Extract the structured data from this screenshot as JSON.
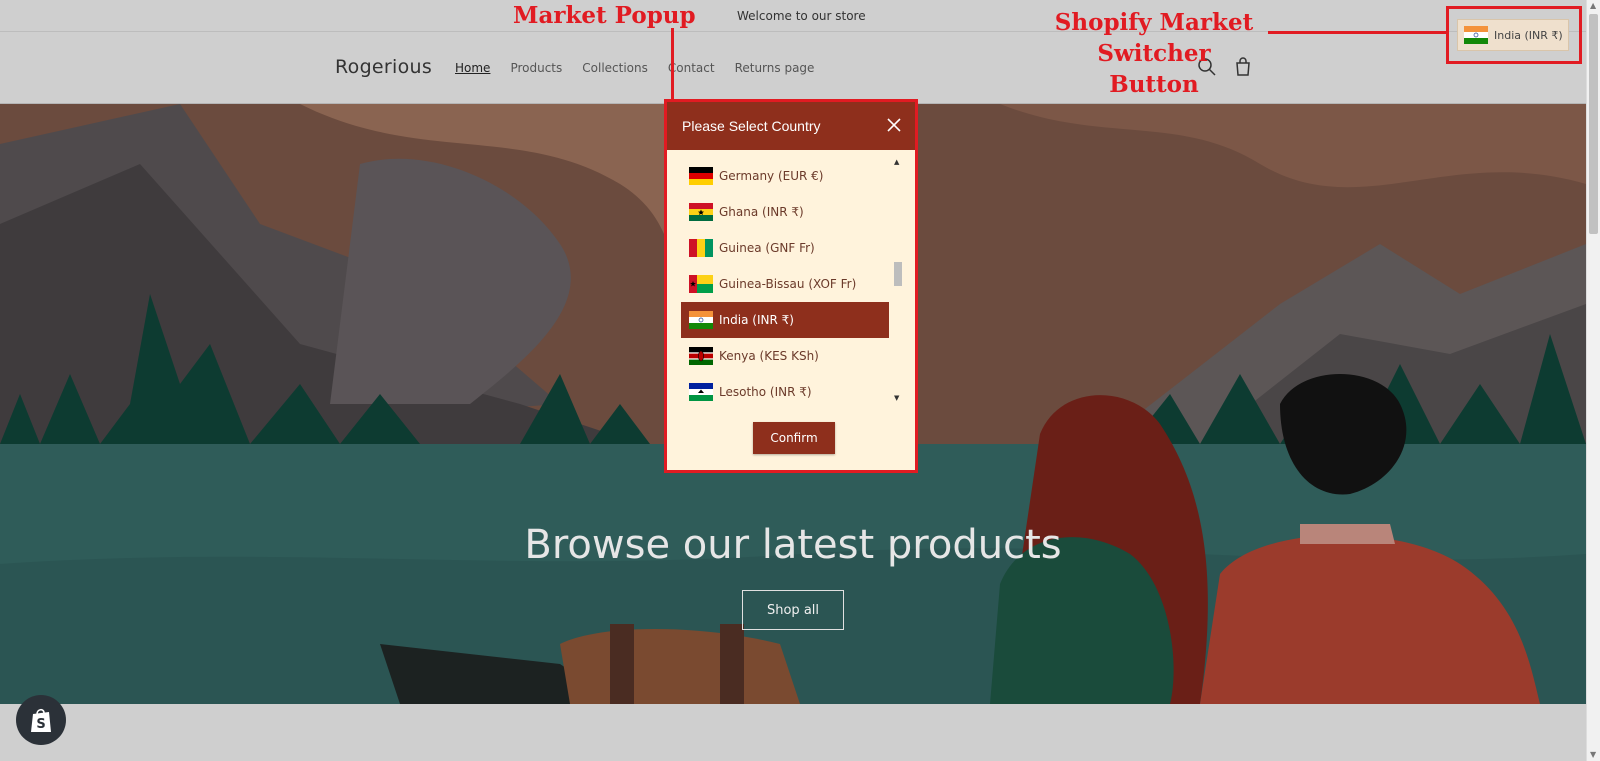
{
  "annotations": {
    "market_popup": "Market Popup",
    "switcher_line1": "Shopify Market",
    "switcher_line2": "Switcher Button",
    "color": "#e11b22"
  },
  "announcement": {
    "text": "Welcome to our store"
  },
  "header": {
    "logo": "Rogerious",
    "nav": [
      "Home",
      "Products",
      "Collections",
      "Contact",
      "Returns page"
    ],
    "active_nav": "Home",
    "icons": [
      "search-icon",
      "cart-icon"
    ]
  },
  "switcher": {
    "label": "India (INR ₹)",
    "flag": "india-flag"
  },
  "hero": {
    "title": "Browse our latest products",
    "button": "Shop all"
  },
  "popup": {
    "title": "Please Select Country",
    "close_icon": "close-icon",
    "countries": [
      {
        "label": "Germany (EUR €)",
        "flag": "germany-flag"
      },
      {
        "label": "Ghana (INR ₹)",
        "flag": "ghana-flag"
      },
      {
        "label": "Guinea (GNF Fr)",
        "flag": "guinea-flag"
      },
      {
        "label": "Guinea-Bissau (XOF Fr)",
        "flag": "guinea-bissau-flag"
      },
      {
        "label": "India (INR ₹)",
        "flag": "india-flag",
        "selected": true
      },
      {
        "label": "Kenya (KES KSh)",
        "flag": "kenya-flag"
      },
      {
        "label": "Lesotho (INR ₹)",
        "flag": "lesotho-flag"
      }
    ],
    "confirm": "Confirm"
  },
  "colors": {
    "accent": "#8e2f1c",
    "popup_bg": "#fff3dc",
    "annotation": "#e11b22"
  }
}
